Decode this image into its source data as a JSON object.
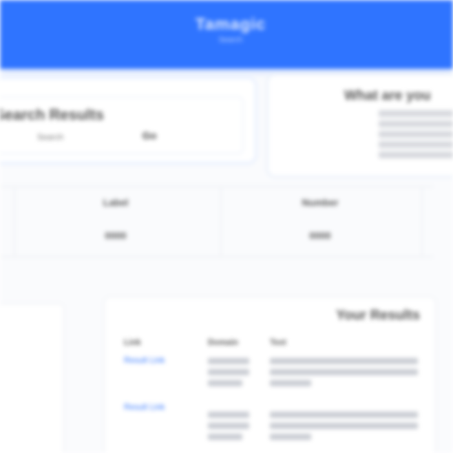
{
  "header": {
    "title": "Tamagic",
    "subtitle": "Search"
  },
  "search": {
    "heading": "Search Results",
    "placeholder": "Search",
    "button_label": "Go"
  },
  "info_panel": {
    "title": "What are you"
  },
  "stats_table": {
    "headers": [
      "Label",
      "Number"
    ],
    "values": [
      "0000",
      "0000"
    ]
  },
  "results": {
    "title": "Your Results",
    "columns": [
      "Link",
      "Domain",
      "Text"
    ],
    "rows": [
      {
        "link": "Result Link",
        "domain": "",
        "text": ""
      },
      {
        "link": "Result Link",
        "domain": "",
        "text": ""
      }
    ]
  },
  "colors": {
    "accent": "#2f74ff",
    "background": "#fafbfd"
  }
}
